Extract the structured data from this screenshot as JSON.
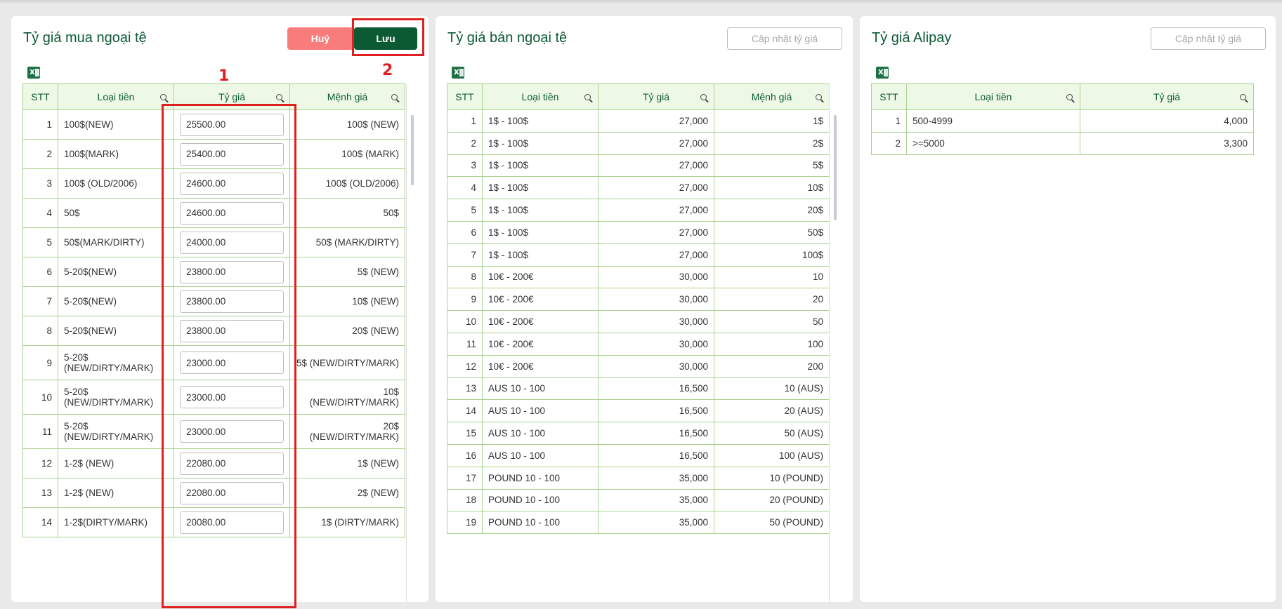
{
  "buy": {
    "title": "Tỷ giá mua ngoại tệ",
    "cancel_label": "Huỷ",
    "save_label": "Lưu",
    "columns": [
      "STT",
      "Loại tiền",
      "Tỷ giá",
      "Mệnh giá"
    ],
    "rows": [
      {
        "stt": "1",
        "type": "100$(NEW)",
        "rate": "25500.00",
        "denom": "100$ (NEW)"
      },
      {
        "stt": "2",
        "type": "100$(MARK)",
        "rate": "25400.00",
        "denom": "100$ (MARK)"
      },
      {
        "stt": "3",
        "type": "100$ (OLD/2006)",
        "rate": "24600.00",
        "denom": "100$ (OLD/2006)"
      },
      {
        "stt": "4",
        "type": "50$",
        "rate": "24600.00",
        "denom": "50$"
      },
      {
        "stt": "5",
        "type": "50$(MARK/DIRTY)",
        "rate": "24000.00",
        "denom": "50$ (MARK/DIRTY)"
      },
      {
        "stt": "6",
        "type": "5-20$(NEW)",
        "rate": "23800.00",
        "denom": "5$ (NEW)"
      },
      {
        "stt": "7",
        "type": "5-20$(NEW)",
        "rate": "23800.00",
        "denom": "10$ (NEW)"
      },
      {
        "stt": "8",
        "type": "5-20$(NEW)",
        "rate": "23800.00",
        "denom": "20$ (NEW)"
      },
      {
        "stt": "9",
        "type": "5-20$ (NEW/DIRTY/MARK)",
        "rate": "23000.00",
        "denom": "5$ (NEW/DIRTY/MARK)"
      },
      {
        "stt": "10",
        "type": "5-20$ (NEW/DIRTY/MARK)",
        "rate": "23000.00",
        "denom": "10$ (NEW/DIRTY/MARK)"
      },
      {
        "stt": "11",
        "type": "5-20$ (NEW/DIRTY/MARK)",
        "rate": "23000.00",
        "denom": "20$ (NEW/DIRTY/MARK)"
      },
      {
        "stt": "12",
        "type": "1-2$ (NEW)",
        "rate": "22080.00",
        "denom": "1$ (NEW)"
      },
      {
        "stt": "13",
        "type": "1-2$ (NEW)",
        "rate": "22080.00",
        "denom": "2$ (NEW)"
      },
      {
        "stt": "14",
        "type": "1-2$(DIRTY/MARK)",
        "rate": "20080.00",
        "denom": "1$ (DIRTY/MARK)"
      }
    ]
  },
  "sell": {
    "title": "Tỷ giá bán ngoại tệ",
    "update_label": "Cập nhật tỷ giá",
    "columns": [
      "STT",
      "Loại tiền",
      "Tỷ giá",
      "Mệnh giá"
    ],
    "rows": [
      {
        "stt": "1",
        "type": "1$ - 100$",
        "rate": "27,000",
        "denom": "1$"
      },
      {
        "stt": "2",
        "type": "1$ - 100$",
        "rate": "27,000",
        "denom": "2$"
      },
      {
        "stt": "3",
        "type": "1$ - 100$",
        "rate": "27,000",
        "denom": "5$"
      },
      {
        "stt": "4",
        "type": "1$ - 100$",
        "rate": "27,000",
        "denom": "10$"
      },
      {
        "stt": "5",
        "type": "1$ - 100$",
        "rate": "27,000",
        "denom": "20$"
      },
      {
        "stt": "6",
        "type": "1$ - 100$",
        "rate": "27,000",
        "denom": "50$"
      },
      {
        "stt": "7",
        "type": "1$ - 100$",
        "rate": "27,000",
        "denom": "100$"
      },
      {
        "stt": "8",
        "type": "10€ - 200€",
        "rate": "30,000",
        "denom": "10"
      },
      {
        "stt": "9",
        "type": "10€ - 200€",
        "rate": "30,000",
        "denom": "20"
      },
      {
        "stt": "10",
        "type": "10€ - 200€",
        "rate": "30,000",
        "denom": "50"
      },
      {
        "stt": "11",
        "type": "10€ - 200€",
        "rate": "30,000",
        "denom": "100"
      },
      {
        "stt": "12",
        "type": "10€ - 200€",
        "rate": "30,000",
        "denom": "200"
      },
      {
        "stt": "13",
        "type": "AUS 10 - 100",
        "rate": "16,500",
        "denom": "10 (AUS)"
      },
      {
        "stt": "14",
        "type": "AUS 10 - 100",
        "rate": "16,500",
        "denom": "20 (AUS)"
      },
      {
        "stt": "15",
        "type": "AUS 10 - 100",
        "rate": "16,500",
        "denom": "50 (AUS)"
      },
      {
        "stt": "16",
        "type": "AUS 10 - 100",
        "rate": "16,500",
        "denom": "100 (AUS)"
      },
      {
        "stt": "17",
        "type": "POUND 10 - 100",
        "rate": "35,000",
        "denom": "10 (POUND)"
      },
      {
        "stt": "18",
        "type": "POUND 10 - 100",
        "rate": "35,000",
        "denom": "20 (POUND)"
      },
      {
        "stt": "19",
        "type": "POUND 10 - 100",
        "rate": "35,000",
        "denom": "50 (POUND)"
      }
    ]
  },
  "alipay": {
    "title": "Tỷ giá Alipay",
    "update_label": "Cập nhật tỷ giá",
    "columns": [
      "STT",
      "Loại tiền",
      "Tỷ giá"
    ],
    "rows": [
      {
        "stt": "1",
        "type": "500-4999",
        "rate": "4,000"
      },
      {
        "stt": "2",
        "type": ">=5000",
        "rate": "3,300"
      }
    ]
  },
  "annotations": {
    "label_1": "1",
    "label_2": "2",
    "color": "#e02020"
  },
  "colors": {
    "brand": "#0b5a33",
    "cancel": "#f87c7c",
    "header_bg": "#eef8e6",
    "border": "#a9d18e"
  }
}
